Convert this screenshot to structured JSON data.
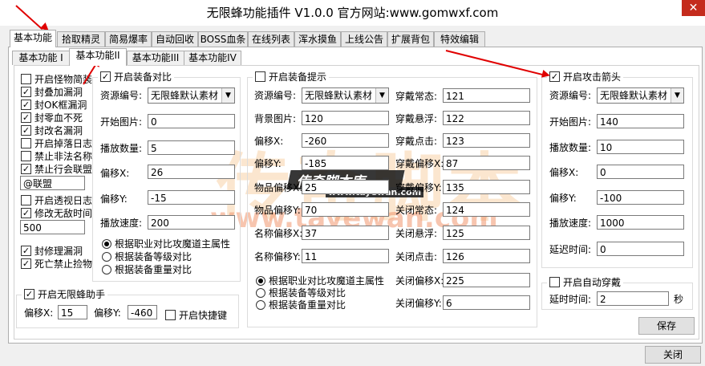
{
  "window": {
    "title": "无限蜂功能插件 V1.0.0 官方网站:www.gomwxf.com",
    "close_glyph": "✕"
  },
  "tabs": [
    "基本功能",
    "拾取精灵",
    "简易爆率",
    "自动回收",
    "BOSS血条",
    "在线列表",
    "浑水摸鱼",
    "上线公告",
    "扩展背包",
    "特效编辑"
  ],
  "subtabs": [
    "基本功能 I",
    "基本功能II",
    "基本功能III",
    "基本功能IV"
  ],
  "left_options": [
    {
      "label": "开启怪物简装",
      "checked": false
    },
    {
      "label": "封叠加漏洞",
      "checked": true
    },
    {
      "label": "封OK框漏洞",
      "checked": true
    },
    {
      "label": "封零血不死",
      "checked": true
    },
    {
      "label": "封改名漏洞",
      "checked": true
    },
    {
      "label": "开启掉落日志",
      "checked": false
    },
    {
      "label": "禁止非法名称",
      "checked": false
    },
    {
      "label": "禁止行会联盟",
      "checked": true
    }
  ],
  "alliance_value": "@联盟",
  "perspective_log": {
    "label": "开启透视日志",
    "checked": false
  },
  "invincible_time": {
    "label": "修改无敌时间",
    "checked": true,
    "value": "500"
  },
  "fix_repair": {
    "label": "封修理漏洞",
    "checked": true
  },
  "death_pickup": {
    "label": "死亡禁止捡物",
    "checked": true
  },
  "equip_compare": {
    "title": "开启装备对比",
    "checked": true,
    "fields": [
      {
        "label": "资源编号:",
        "value": "无限蜂默认素材",
        "type": "select"
      },
      {
        "label": "开始图片:",
        "value": "0"
      },
      {
        "label": "播放数量:",
        "value": "5"
      },
      {
        "label": "偏移X:",
        "value": "26"
      },
      {
        "label": "偏移Y:",
        "value": "-15"
      },
      {
        "label": "播放速度:",
        "value": "200"
      }
    ],
    "radios": [
      {
        "label": "根据职业对比攻魔道主属性",
        "on": true
      },
      {
        "label": "根据装备等级对比",
        "on": false
      },
      {
        "label": "根据装备重量对比",
        "on": false
      }
    ]
  },
  "bee_helper": {
    "title": "开启无限蜂助手",
    "checked": true,
    "offx_label": "偏移X:",
    "offx": "15",
    "offy_label": "偏移Y:",
    "offy": "-460",
    "hotkey_label": "开启快捷键",
    "hotkey_checked": false
  },
  "equip_tip": {
    "title": "开启装备提示",
    "checked": false,
    "left_fields": [
      {
        "label": "资源编号:",
        "value": "无限蜂默认素材",
        "type": "select"
      },
      {
        "label": "背景图片:",
        "value": "120"
      },
      {
        "label": "偏移X:",
        "value": "-260"
      },
      {
        "label": "偏移Y:",
        "value": "-185"
      },
      {
        "label": "物品偏移X:",
        "value": "25"
      },
      {
        "label": "物品偏移Y:",
        "value": "70"
      },
      {
        "label": "名称偏移X:",
        "value": "37"
      },
      {
        "label": "名称偏移Y:",
        "value": "11"
      }
    ],
    "right_fields": [
      {
        "label": "穿戴常态:",
        "value": "121"
      },
      {
        "label": "穿戴悬浮:",
        "value": "122"
      },
      {
        "label": "穿戴点击:",
        "value": "123"
      },
      {
        "label": "穿戴偏移X:",
        "value": "87"
      },
      {
        "label": "穿戴偏移Y:",
        "value": "135"
      },
      {
        "label": "关闭常态:",
        "value": "124"
      },
      {
        "label": "关闭悬浮:",
        "value": "125"
      },
      {
        "label": "关闭点击:",
        "value": "126"
      },
      {
        "label": "关闭偏移X:",
        "value": "225"
      },
      {
        "label": "关闭偏移Y:",
        "value": "6"
      }
    ],
    "radios": [
      {
        "label": "根据职业对比攻魔道主属性",
        "on": true
      },
      {
        "label": "根据装备等级对比",
        "on": false
      },
      {
        "label": "根据装备重量对比",
        "on": false
      }
    ]
  },
  "attack_arrow": {
    "title": "开启攻击箭头",
    "checked": true,
    "fields": [
      {
        "label": "资源编号:",
        "value": "无限蜂默认素材",
        "type": "select"
      },
      {
        "label": "开始图片:",
        "value": "140"
      },
      {
        "label": "播放数量:",
        "value": "10"
      },
      {
        "label": "偏移X:",
        "value": "0"
      },
      {
        "label": "偏移Y:",
        "value": "-100"
      },
      {
        "label": "播放速度:",
        "value": "1000"
      },
      {
        "label": "延迟时间:",
        "value": "0"
      }
    ]
  },
  "auto_wear": {
    "title": "开启自动穿戴",
    "checked": false,
    "delay_label": "延时时间:",
    "delay": "2",
    "unit": "秒"
  },
  "buttons": {
    "save": "保存",
    "close": "关闭"
  },
  "watermark": {
    "main": "传奇脚本库",
    "url": "www.tayewan.com",
    "big": "传奇脚本",
    "url_small": "www.tayewan.com"
  }
}
